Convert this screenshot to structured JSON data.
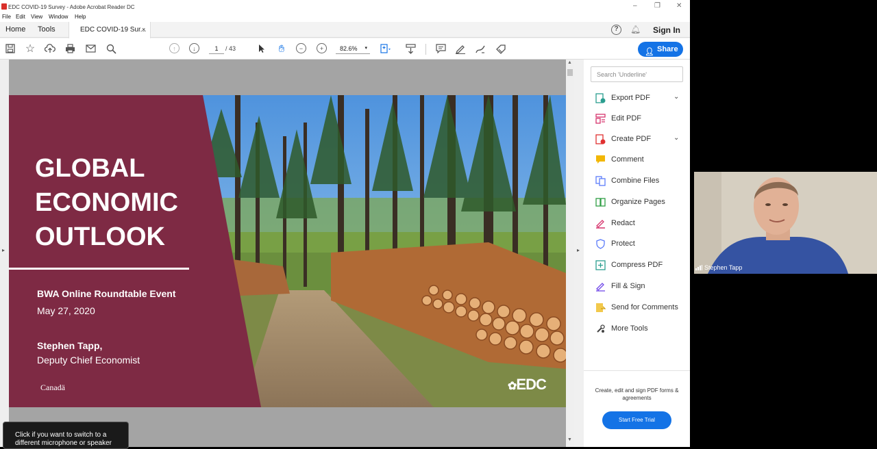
{
  "window": {
    "title": "EDC COVID-19 Survey - Adobe Acrobat Reader DC",
    "menu": [
      "File",
      "Edit",
      "View",
      "Window",
      "Help"
    ]
  },
  "tabs": {
    "home": "Home",
    "tools": "Tools",
    "document": "EDC COVID-19 Sur...",
    "close": "×",
    "help": "?",
    "sign_in": "Sign In"
  },
  "toolbar": {
    "page_current": "1",
    "page_total": "/ 43",
    "zoom": "82.6%",
    "share_label": "Share"
  },
  "slide": {
    "title": "GLOBAL\nECONOMIC\nOUTLOOK",
    "event": "BWA Online Roundtable Event",
    "date": "May 27, 2020",
    "presenter": "Stephen Tapp,",
    "role": "Deputy Chief Economist",
    "canada_wordmark": "Canadä",
    "edc_logo": "EDC"
  },
  "tools_pane": {
    "search_placeholder": "Search 'Underline'",
    "items": [
      {
        "label": "Export PDF",
        "icon": "export-pdf-icon",
        "expandable": true
      },
      {
        "label": "Edit PDF",
        "icon": "edit-pdf-icon",
        "expandable": false
      },
      {
        "label": "Create PDF",
        "icon": "create-pdf-icon",
        "expandable": true
      },
      {
        "label": "Comment",
        "icon": "comment-icon",
        "expandable": false
      },
      {
        "label": "Combine Files",
        "icon": "combine-files-icon",
        "expandable": false
      },
      {
        "label": "Organize Pages",
        "icon": "organize-pages-icon",
        "expandable": false
      },
      {
        "label": "Redact",
        "icon": "redact-icon",
        "expandable": false
      },
      {
        "label": "Protect",
        "icon": "protect-icon",
        "expandable": false
      },
      {
        "label": "Compress PDF",
        "icon": "compress-pdf-icon",
        "expandable": false
      },
      {
        "label": "Fill & Sign",
        "icon": "fill-sign-icon",
        "expandable": false
      },
      {
        "label": "Send for Comments",
        "icon": "send-for-comments-icon",
        "expandable": false
      },
      {
        "label": "More Tools",
        "icon": "more-tools-icon",
        "expandable": false
      }
    ],
    "promo_text": "Create, edit and sign PDF forms & agreements",
    "trial_button": "Start Free Trial"
  },
  "tooltip": {
    "text": "Click if you want to switch to a different microphone or speaker"
  },
  "video": {
    "participant_name": "Stephen Tapp"
  },
  "colors": {
    "slide_maroon": "#7e2a44",
    "acrobat_blue": "#1473e6",
    "acrobat_red": "#d9302b"
  }
}
